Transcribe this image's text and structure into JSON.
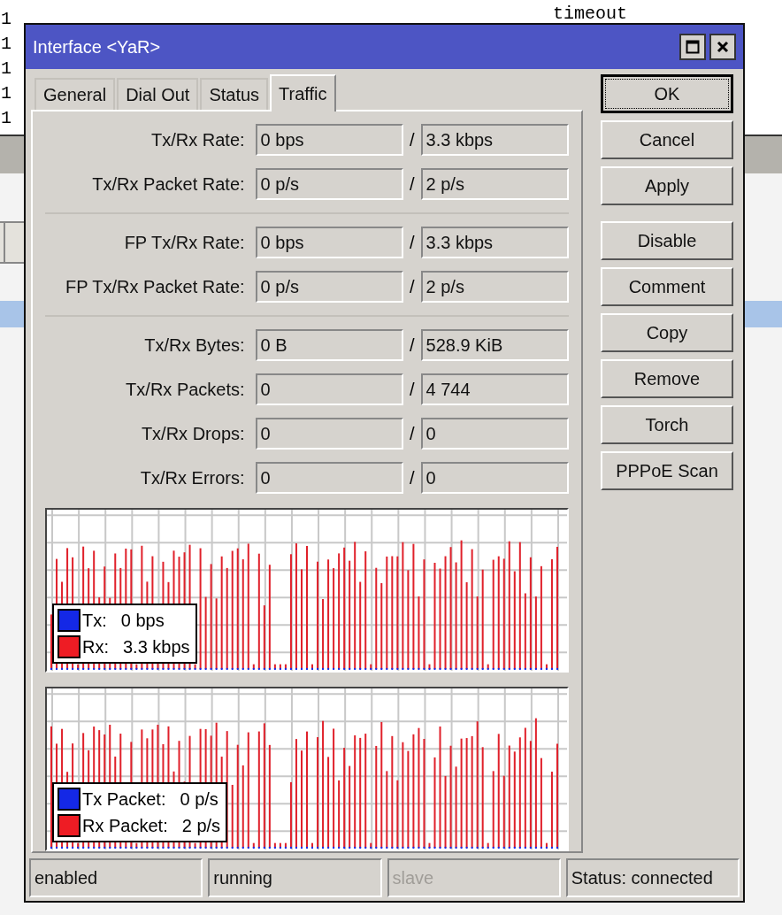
{
  "background": {
    "lines": [
      "1",
      "1",
      "1",
      "1",
      "1"
    ],
    "header": "timeout"
  },
  "window": {
    "title": "Interface <YaR>"
  },
  "tabs": [
    {
      "label": "General",
      "selected": false
    },
    {
      "label": "Dial Out",
      "selected": false
    },
    {
      "label": "Status",
      "selected": false
    },
    {
      "label": "Traffic",
      "selected": true
    }
  ],
  "stat_groups": [
    [
      {
        "label": "Tx/Rx Rate:",
        "tx": "0 bps",
        "rx": "3.3 kbps"
      },
      {
        "label": "Tx/Rx Packet Rate:",
        "tx": "0 p/s",
        "rx": "2 p/s"
      }
    ],
    [
      {
        "label": "FP Tx/Rx Rate:",
        "tx": "0 bps",
        "rx": "3.3 kbps"
      },
      {
        "label": "FP Tx/Rx Packet Rate:",
        "tx": "0 p/s",
        "rx": "2 p/s"
      }
    ],
    [
      {
        "label": "Tx/Rx Bytes:",
        "tx": "0 B",
        "rx": "528.9 KiB"
      },
      {
        "label": "Tx/Rx Packets:",
        "tx": "0",
        "rx": "4 744"
      },
      {
        "label": "Tx/Rx Drops:",
        "tx": "0",
        "rx": "0"
      },
      {
        "label": "Tx/Rx Errors:",
        "tx": "0",
        "rx": "0"
      }
    ]
  ],
  "slash": "/",
  "graphs": [
    {
      "legend": [
        {
          "label": "Tx:",
          "value": "0 bps",
          "color": "#1428e6"
        },
        {
          "label": "Rx:",
          "value": "3.3 kbps",
          "color": "#ee1c24"
        }
      ]
    },
    {
      "legend": [
        {
          "label": "Tx Packet:",
          "value": "0 p/s",
          "color": "#1428e6"
        },
        {
          "label": "Rx Packet:",
          "value": "2 p/s",
          "color": "#ee1c24"
        }
      ]
    }
  ],
  "button_groups": [
    [
      {
        "label": "OK",
        "default": true
      },
      {
        "label": "Cancel",
        "default": false
      },
      {
        "label": "Apply",
        "default": false
      }
    ],
    [
      {
        "label": "Disable",
        "default": false
      },
      {
        "label": "Comment",
        "default": false
      },
      {
        "label": "Copy",
        "default": false
      },
      {
        "label": "Remove",
        "default": false
      },
      {
        "label": "Torch",
        "default": false
      },
      {
        "label": "PPPoE Scan",
        "default": false
      }
    ]
  ],
  "status_bar": [
    {
      "text": "enabled",
      "disabled": false
    },
    {
      "text": "running",
      "disabled": false
    },
    {
      "text": "slave",
      "disabled": true
    },
    {
      "text": "Status: connected",
      "disabled": false
    }
  ]
}
